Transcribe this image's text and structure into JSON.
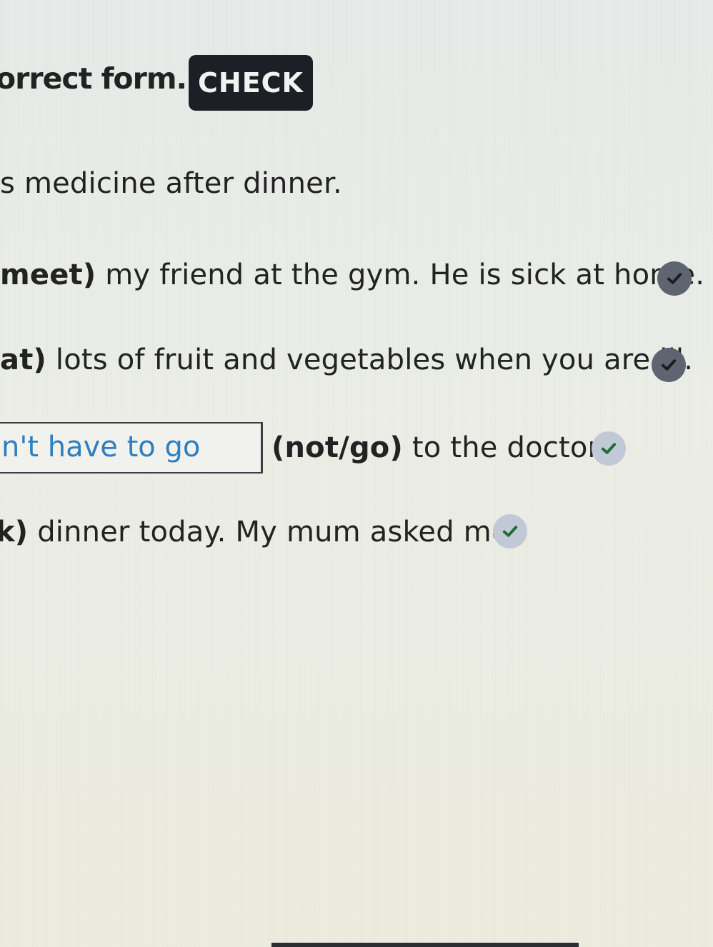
{
  "instructions": {
    "text": "orrect form.",
    "check_label": "CHECK"
  },
  "items": [
    {
      "rest": "s medicine after dinner."
    },
    {
      "verb": "meet)",
      "rest": " my friend at the gym. He is sick at home."
    },
    {
      "verb": "at)",
      "rest": " lots of fruit and vegetables when you are ill."
    },
    {
      "answer": "n't have to go",
      "verb": "(not/go)",
      "rest": " to the doctor."
    },
    {
      "verb": "k)",
      "rest": " dinner today. My mum asked me."
    }
  ],
  "colors": {
    "answer_text": "#2d7fc0",
    "check_button_bg": "#1c1f26",
    "tick_green": "#1f6b3a",
    "tick_badge_dark": "#5e6470",
    "tick_badge_light": "#c2c9d6"
  },
  "icons": [
    "checkmark-icon"
  ]
}
